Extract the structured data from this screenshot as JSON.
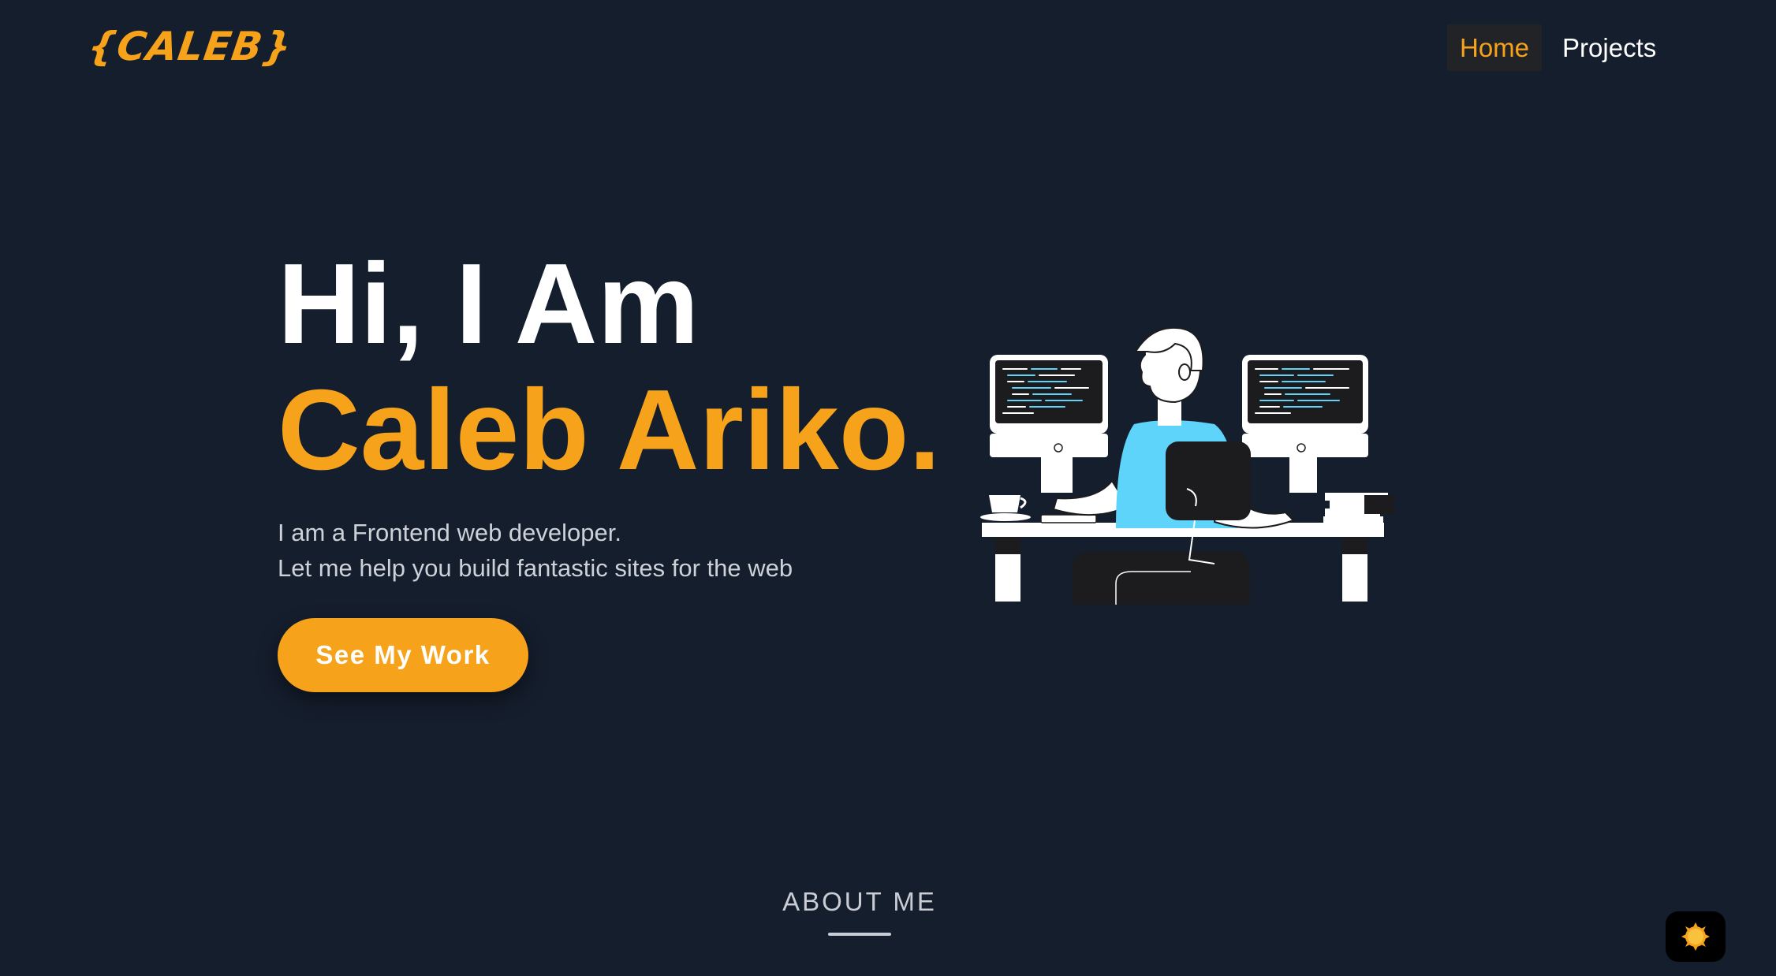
{
  "header": {
    "logo_text": "{CALEB}",
    "nav": [
      {
        "label": "Home",
        "active": true
      },
      {
        "label": "Projects",
        "active": false
      }
    ]
  },
  "hero": {
    "greeting": "Hi, I Am",
    "name": "Caleb Ariko.",
    "tagline_line1": "I am a Frontend web developer.",
    "tagline_line2": "Let me help you build fantastic sites for the web",
    "cta_label": "See My Work",
    "illustration": "developer-at-desk-illustration"
  },
  "about": {
    "heading": "ABOUT ME"
  },
  "theme_toggle": {
    "icon": "sun-icon"
  },
  "colors": {
    "background": "#151e2d",
    "accent": "#f7a21b",
    "text": "#ffffff",
    "muted_text": "#cdd1d8",
    "nav_active_bg": "#222326",
    "illustration_shirt": "#5ed4fb"
  }
}
